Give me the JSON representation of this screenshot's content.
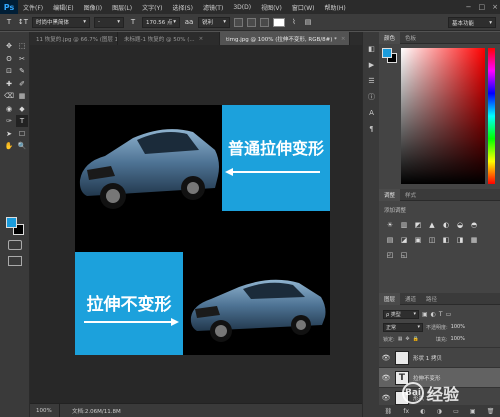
{
  "app": {
    "logo": "Ps",
    "menu": [
      "文件(F)",
      "编辑(E)",
      "图像(I)",
      "图层(L)",
      "文字(Y)",
      "选择(S)",
      "滤镜(T)",
      "3D(D)",
      "视图(V)",
      "窗口(W)",
      "帮助(H)"
    ],
    "window_controls": [
      "−",
      "□",
      "×"
    ]
  },
  "options_bar": {
    "tool_icon": "T",
    "orient_icon": "↕T",
    "font_family": "时尚中黑简体",
    "font_style": "-",
    "size_icon": "T",
    "font_size": "170.56 点",
    "aa_icon": "aa",
    "antialias": "锐利",
    "workspace": "基本功能"
  },
  "tabs": [
    {
      "label": "11 恢复的.jpg @ 66.7% (图层 1, ...",
      "active": false
    },
    {
      "label": "未标题-1 恢复的 @ 50% (...",
      "active": false
    },
    {
      "label": "timg.jpg @ 100% (拉伸不变形, RGB/8#) *",
      "active": true
    }
  ],
  "tools": [
    "✥",
    "⬚",
    "ʘ",
    "✂",
    "⊡",
    "✎",
    "✚",
    "✐",
    "⌫",
    "▦",
    "◉",
    "◆",
    "✑",
    "T",
    "➤",
    "☐",
    "✋",
    "🔍"
  ],
  "canvas": {
    "top_text": "普通拉伸变形",
    "bottom_text": "拉伸不变形",
    "accent_color": "#1ca1dc"
  },
  "status": {
    "zoom": "100%",
    "doc": "文档:2.06M/11.8M"
  },
  "panels": {
    "color_tabs": [
      "颜色",
      "色板"
    ],
    "adjust_tabs": [
      "调整",
      "样式"
    ],
    "adjust_label": "添加调整",
    "adjust_icons": [
      "☀",
      "▥",
      "◩",
      "▲",
      "◐",
      "◒",
      "◓",
      "▤",
      "◪",
      "▣",
      "◫",
      "◧",
      "◨",
      "▦",
      "◰",
      "◱",
      "◲",
      "◳"
    ],
    "layers_tabs": [
      "图层",
      "通道",
      "路径"
    ],
    "kind_label": "ρ 类型",
    "blend_mode": "正常",
    "opacity_label": "不透明度:",
    "opacity": "100%",
    "lock_label": "锁定:",
    "fill_label": "填充:",
    "fill": "100%",
    "layers": [
      {
        "name": "形状 1 拷贝",
        "type": "shape",
        "selected": false
      },
      {
        "name": "拉伸不变形",
        "type": "text",
        "selected": true
      },
      {
        "name": "形状 1",
        "type": "shape",
        "selected": false
      }
    ],
    "layer_footer_icons": [
      "⛓",
      "fx",
      "◐",
      "◑",
      "▭",
      "▣",
      "🗑"
    ]
  },
  "watermark": "经验"
}
